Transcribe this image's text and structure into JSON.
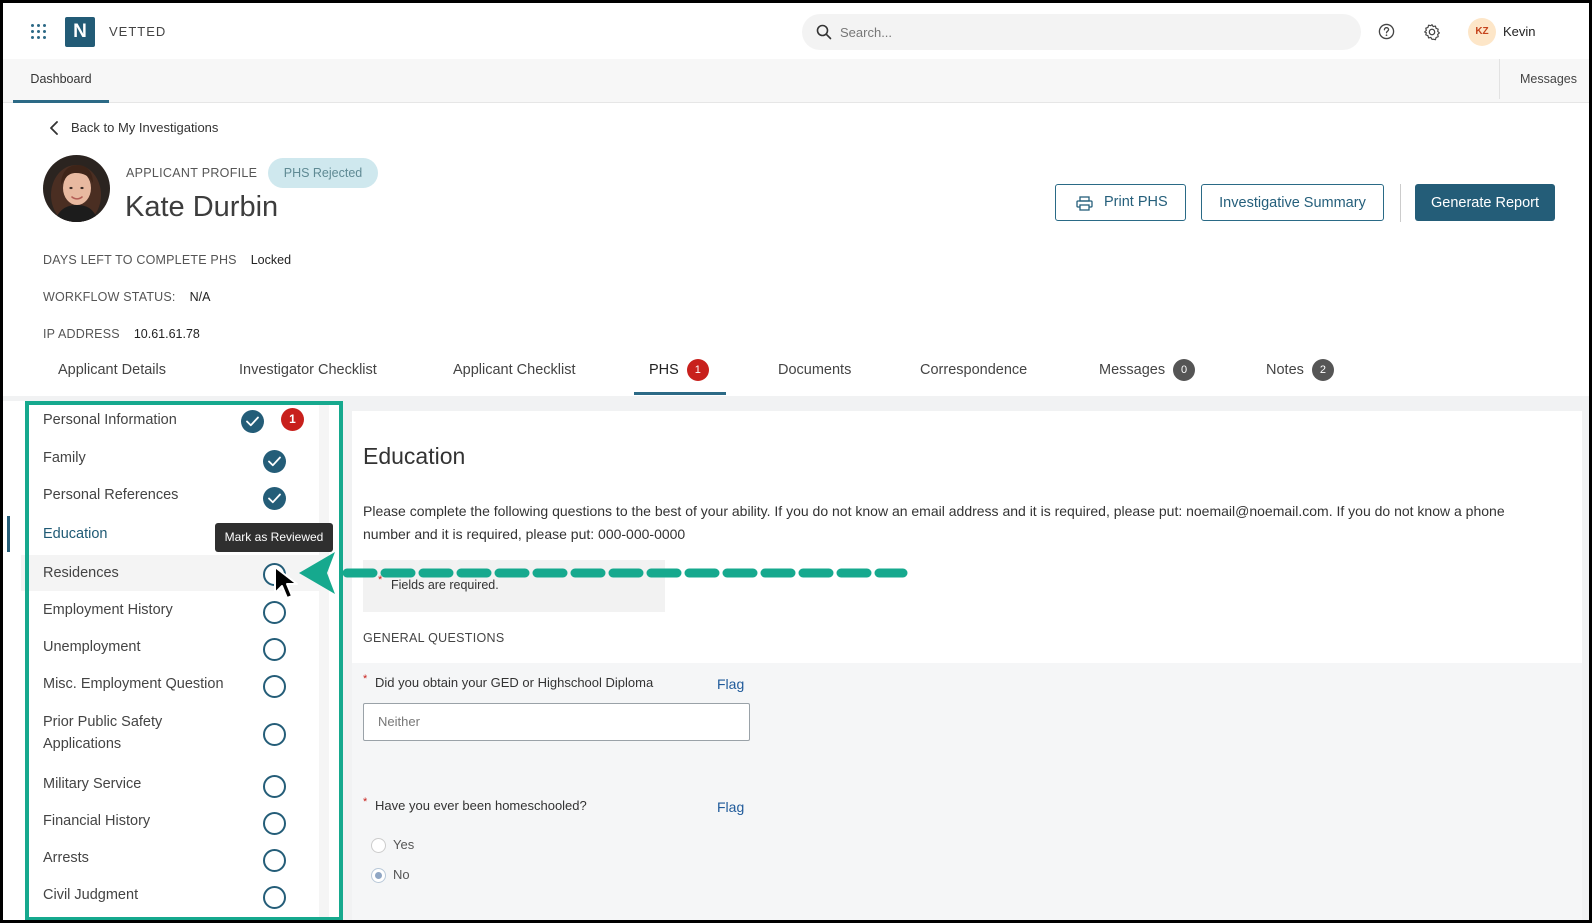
{
  "header": {
    "brand": "VETTED",
    "logo_letter": "N",
    "search_placeholder": "Search...",
    "user_initials": "KZ",
    "user_name": "Kevin"
  },
  "nav": {
    "dashboard": "Dashboard",
    "messages": "Messages"
  },
  "profile": {
    "back_label": "Back to My Investigations",
    "section_label": "APPLICANT PROFILE",
    "status": "PHS Rejected",
    "name": "Kate Durbin",
    "days_left_label": "DAYS LEFT TO COMPLETE PHS",
    "days_left_value": "Locked",
    "workflow_label": "WORKFLOW STATUS:",
    "workflow_value": "N/A",
    "ip_label": "IP ADDRESS",
    "ip_value": "10.61.61.78"
  },
  "actions": {
    "print": "Print PHS",
    "summary": "Investigative Summary",
    "generate": "Generate Report"
  },
  "tabs": [
    {
      "label": "Applicant Details"
    },
    {
      "label": "Investigator Checklist"
    },
    {
      "label": "Applicant Checklist"
    },
    {
      "label": "PHS",
      "count": "1"
    },
    {
      "label": "Documents"
    },
    {
      "label": "Correspondence"
    },
    {
      "label": "Messages",
      "count": "0"
    },
    {
      "label": "Notes",
      "count": "2"
    }
  ],
  "sidebar": {
    "items": [
      {
        "label": "Personal Information",
        "status": "reviewed",
        "alert": "1"
      },
      {
        "label": "Family",
        "status": "reviewed"
      },
      {
        "label": "Personal References",
        "status": "reviewed"
      },
      {
        "label": "Education",
        "status": "current"
      },
      {
        "label": "Residences",
        "status": "pending"
      },
      {
        "label": "Employment History",
        "status": "pending"
      },
      {
        "label": "Unemployment",
        "status": "pending"
      },
      {
        "label": "Misc. Employment Question",
        "status": "pending"
      },
      {
        "label": "Prior Public Safety Applications",
        "status": "pending"
      },
      {
        "label": "Military Service",
        "status": "pending"
      },
      {
        "label": "Financial History",
        "status": "pending"
      },
      {
        "label": "Arrests",
        "status": "pending"
      },
      {
        "label": "Civil Judgment",
        "status": "pending"
      }
    ],
    "tooltip": "Mark as Reviewed"
  },
  "main": {
    "title": "Education",
    "description": "Please complete the following questions to the best of your ability. If you do not know an email address and it is required, please put: noemail@noemail.com. If you do not know a phone number and it is required, please put: 000-000-0000",
    "required_note": "Fields are required.",
    "section": "GENERAL QUESTIONS",
    "q1": {
      "label": "Did you obtain your GED or Highschool Diploma",
      "flag": "Flag",
      "value": "Neither"
    },
    "q2": {
      "label": "Have you ever been homeschooled?",
      "flag": "Flag",
      "options": [
        "Yes",
        "No"
      ],
      "selected": "No"
    }
  },
  "colors": {
    "primary": "#245d78",
    "alert": "#c8201c",
    "highlight": "#16a98e"
  }
}
